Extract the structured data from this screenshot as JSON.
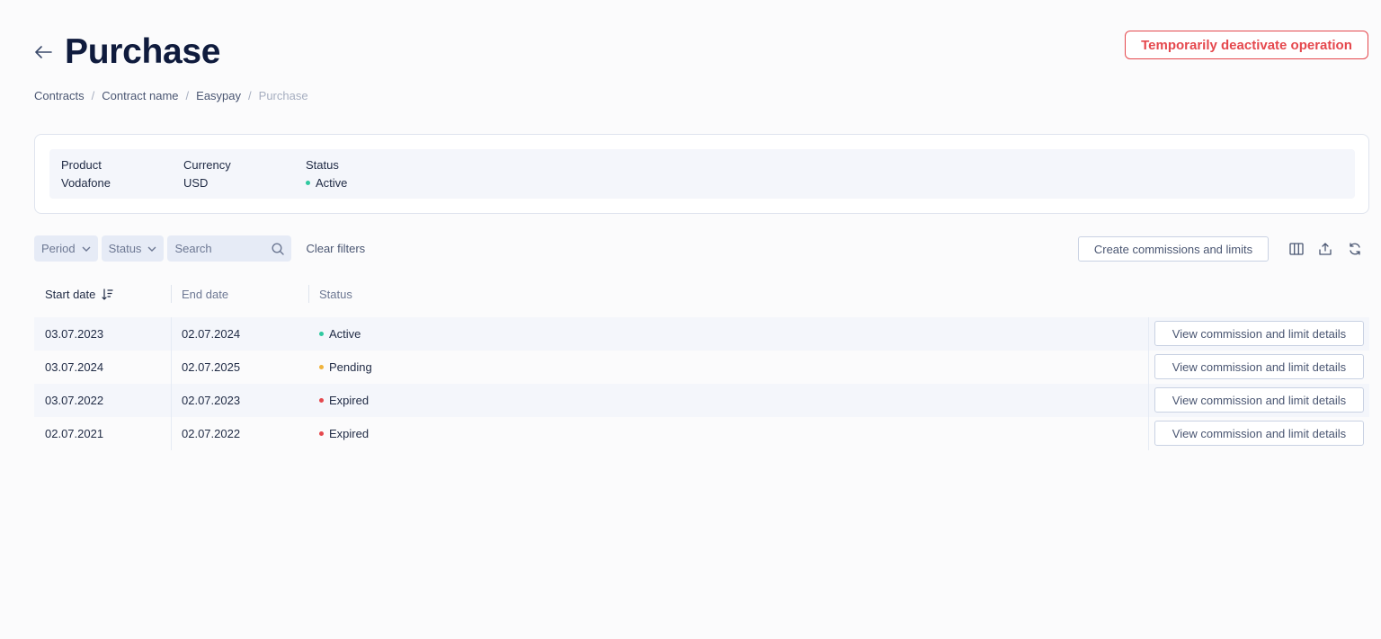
{
  "header": {
    "title": "Purchase",
    "deactivate_label": "Temporarily deactivate operation"
  },
  "breadcrumb": [
    "Contracts",
    "Contract name",
    "Easypay",
    "Purchase"
  ],
  "info": {
    "product_label": "Product",
    "product_value": "Vodafone",
    "currency_label": "Currency",
    "currency_value": "USD",
    "status_label": "Status",
    "status_value": "Active"
  },
  "filters": {
    "period": "Period",
    "status": "Status",
    "search_placeholder": "Search",
    "clear": "Clear filters"
  },
  "toolbar": {
    "create_label": "Create commissions and limits"
  },
  "table": {
    "headers": [
      "Start date",
      "End date",
      "Status"
    ],
    "rows": [
      {
        "start": "03.07.2023",
        "end": "02.07.2024",
        "status": "Active",
        "action": "View commission and limit details"
      },
      {
        "start": "03.07.2024",
        "end": "02.07.2025",
        "status": "Pending",
        "action": "View commission and limit details"
      },
      {
        "start": "03.07.2022",
        "end": "02.07.2023",
        "status": "Expired",
        "action": "View commission and limit details"
      },
      {
        "start": "02.07.2021",
        "end": "02.07.2022",
        "status": "Expired",
        "action": "View commission and limit details"
      }
    ]
  },
  "colors": {
    "active": "#2fc9a0",
    "pending": "#f0b33c",
    "expired": "#e5484d",
    "danger": "#e5484d"
  }
}
